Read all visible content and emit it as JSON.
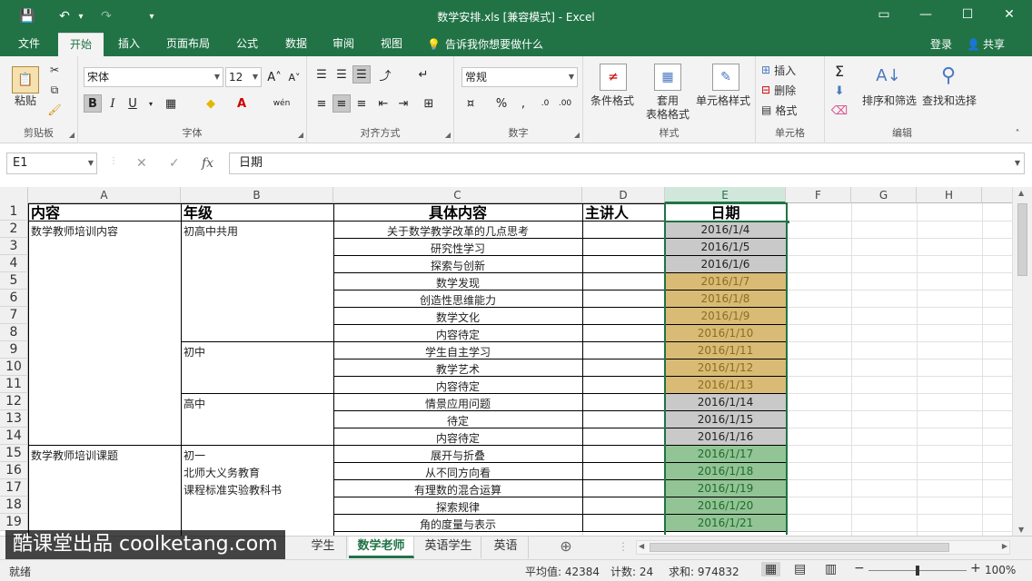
{
  "window": {
    "title": "数学安排.xls  [兼容模式] - Excel",
    "controls": {
      "ribbon_display": "▭",
      "minimize": "—",
      "maximize": "☐",
      "close": "✕"
    }
  },
  "quick_access": {
    "save": "💾",
    "undo": "↶",
    "undo_dd": "▾",
    "redo": "↷",
    "customize": "▾"
  },
  "ribbon_tabs": [
    "文件",
    "开始",
    "插入",
    "页面布局",
    "公式",
    "数据",
    "审阅",
    "视图"
  ],
  "active_tab": "开始",
  "tell_me": "告诉我你想要做什么",
  "account": {
    "login": "登录",
    "share": "共享"
  },
  "ribbon": {
    "clipboard": {
      "label": "剪贴板",
      "paste": "粘贴"
    },
    "font": {
      "label": "字体",
      "name": "宋体",
      "size": "12",
      "grow": "A˄",
      "shrink": "A˅",
      "bold": "B",
      "italic": "I",
      "underline": "U",
      "wen": "wén"
    },
    "alignment": {
      "label": "对齐方式"
    },
    "number": {
      "label": "数字",
      "format": "常规",
      "percent": "%",
      "comma": ","
    },
    "styles": {
      "label": "样式",
      "conditional": "条件格式",
      "table1": "套用",
      "table2": "表格格式",
      "cell_styles": "单元格样式"
    },
    "cells": {
      "label": "单元格",
      "insert": "插入",
      "delete": "删除",
      "format": "格式"
    },
    "editing": {
      "label": "编辑",
      "sort": "排序和筛选",
      "find": "查找和选择"
    }
  },
  "formula_bar": {
    "name_box": "E1",
    "cancel": "✕",
    "enter": "✓",
    "fx": "fx",
    "value": "日期"
  },
  "columns": [
    "A",
    "B",
    "C",
    "D",
    "E",
    "F",
    "G",
    "H"
  ],
  "selected_column": "E",
  "rows": [
    "1",
    "2",
    "3",
    "4",
    "5",
    "6",
    "7",
    "8",
    "9",
    "10",
    "11",
    "12",
    "13",
    "14",
    "15",
    "16",
    "17",
    "18",
    "19"
  ],
  "headers": {
    "A": "内容",
    "B": "年级",
    "C": "具体内容",
    "D": "主讲人",
    "E": "日期"
  },
  "col_a": {
    "r2": "数学教师培训内容",
    "r15": "数学教师培训课题"
  },
  "col_b": {
    "r2": "初高中共用",
    "r9": "初中",
    "r12": "高中",
    "r15": "初一",
    "r16": "北师大义务教育",
    "r17": "课程标准实验教科书"
  },
  "table_rows": [
    {
      "c": "关于数学教学改革的几点思考",
      "e": "2016/1/4",
      "fill": "#c9c9c9",
      "color": "#222222"
    },
    {
      "c": "研究性学习",
      "e": "2016/1/5",
      "fill": "#c9c9c9",
      "color": "#222222"
    },
    {
      "c": "探索与创新",
      "e": "2016/1/6",
      "fill": "#c9c9c9",
      "color": "#222222"
    },
    {
      "c": "数学发现",
      "e": "2016/1/7",
      "fill": "#d9bb76",
      "color": "#8c6d1f"
    },
    {
      "c": "创造性思维能力",
      "e": "2016/1/8",
      "fill": "#d9bb76",
      "color": "#8c6d1f"
    },
    {
      "c": "数学文化",
      "e": "2016/1/9",
      "fill": "#d9bb76",
      "color": "#8c6d1f"
    },
    {
      "c": "内容待定",
      "e": "2016/1/10",
      "fill": "#d9bb76",
      "color": "#8c6d1f"
    },
    {
      "c": "学生自主学习",
      "e": "2016/1/11",
      "fill": "#d9bb76",
      "color": "#8c6d1f"
    },
    {
      "c": "教学艺术",
      "e": "2016/1/12",
      "fill": "#d9bb76",
      "color": "#8c6d1f"
    },
    {
      "c": "内容待定",
      "e": "2016/1/13",
      "fill": "#d9bb76",
      "color": "#8c6d1f"
    },
    {
      "c": "情景应用问题",
      "e": "2016/1/14",
      "fill": "#c9c9c9",
      "color": "#222222"
    },
    {
      "c": "待定",
      "e": "2016/1/15",
      "fill": "#c9c9c9",
      "color": "#222222"
    },
    {
      "c": "内容待定",
      "e": "2016/1/16",
      "fill": "#c9c9c9",
      "color": "#222222"
    },
    {
      "c": "展开与折叠",
      "e": "2016/1/17",
      "fill": "#92c496",
      "color": "#1f6b2a"
    },
    {
      "c": "从不同方向看",
      "e": "2016/1/18",
      "fill": "#92c496",
      "color": "#1f6b2a"
    },
    {
      "c": "有理数的混合运算",
      "e": "2016/1/19",
      "fill": "#92c496",
      "color": "#1f6b2a"
    },
    {
      "c": "探索规律",
      "e": "2016/1/20",
      "fill": "#92c496",
      "color": "#1f6b2a"
    },
    {
      "c": "角的度量与表示",
      "e": "2016/1/21",
      "fill": "#92c496",
      "color": "#1f6b2a"
    }
  ],
  "sheet_tabs": [
    "学生",
    "数学老师",
    "英语学生",
    "英语"
  ],
  "active_sheet": "数学老师",
  "add_sheet": "⊕",
  "status": {
    "mode": "就绪",
    "average": "平均值: 42384",
    "count": "计数: 24",
    "sum": "求和: 974832",
    "zoom": "100%",
    "zoom_level": 0.5
  },
  "watermark": "酷课堂出品 coolketang.com",
  "colors": {
    "brand": "#217346",
    "selected_header": "#d2e7db"
  }
}
